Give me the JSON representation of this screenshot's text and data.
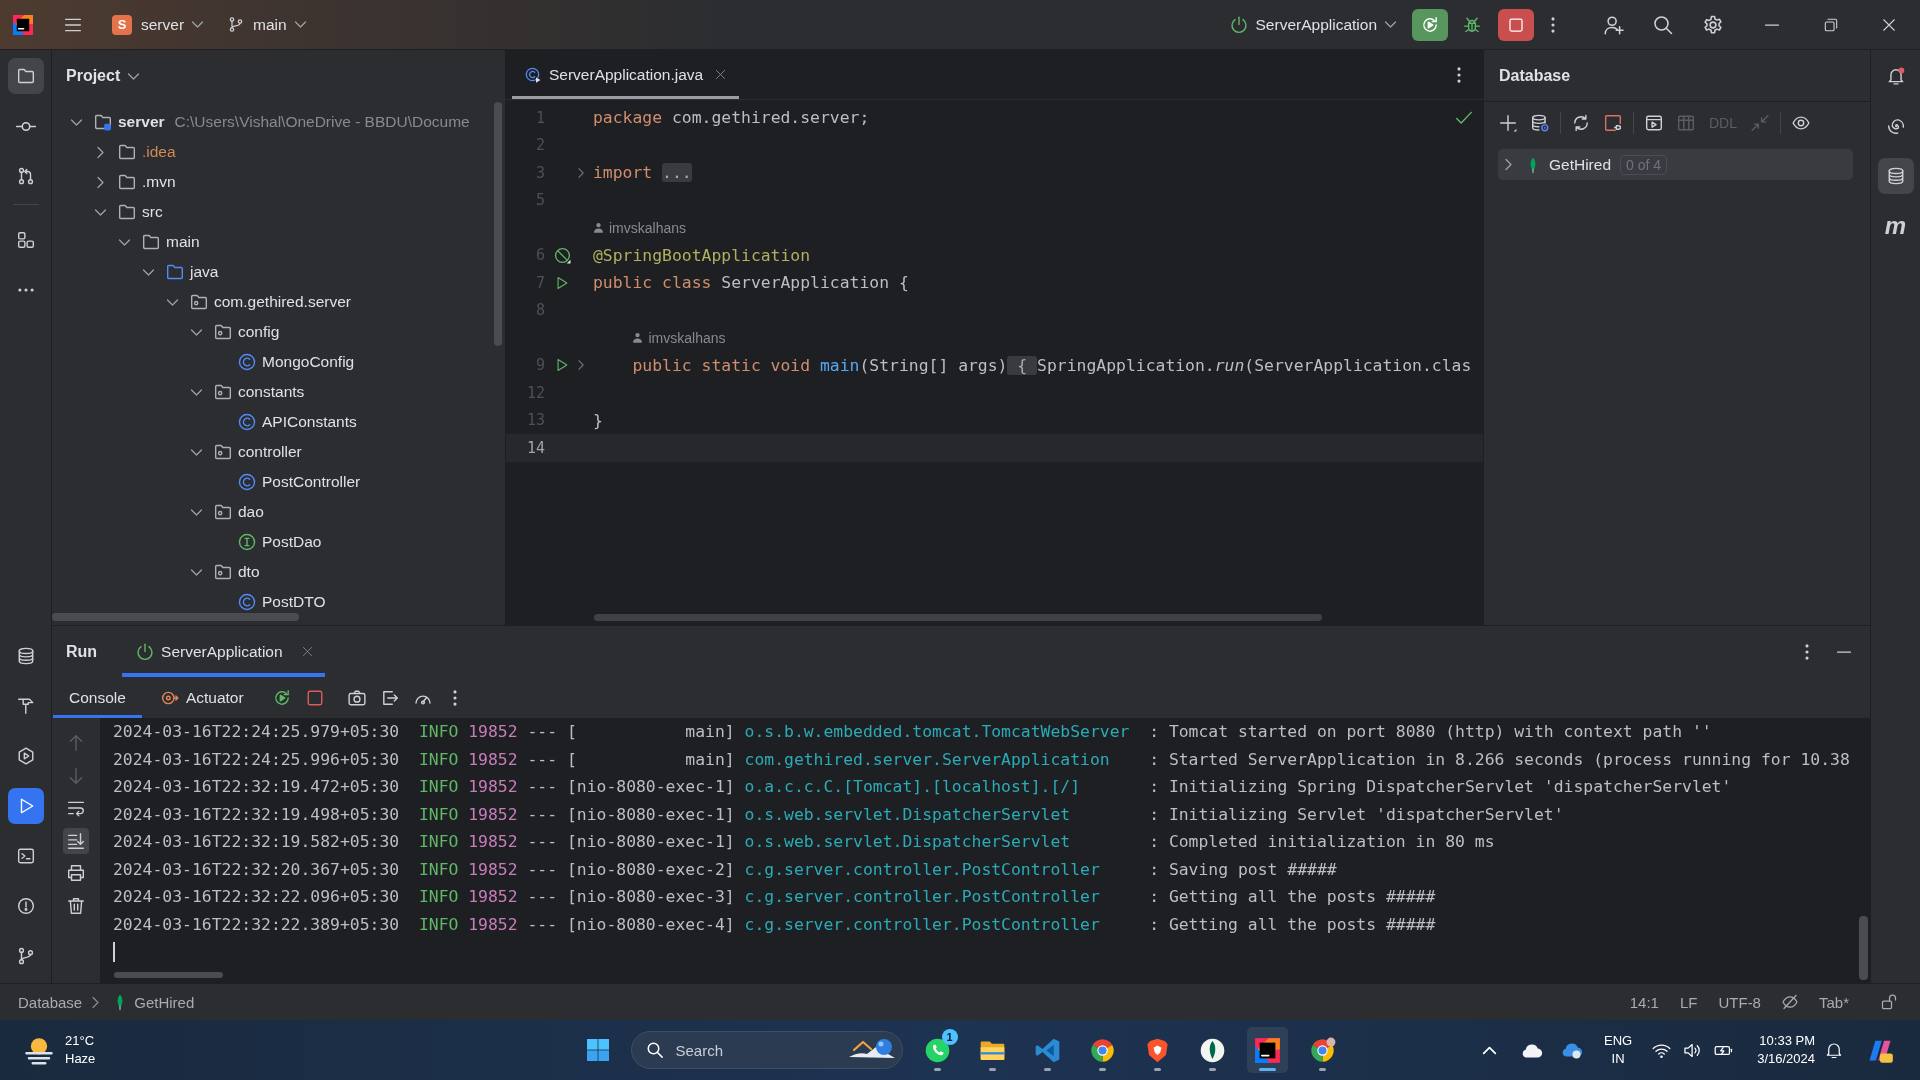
{
  "title_bar": {
    "project": {
      "initial": "S",
      "name": "server"
    },
    "branch": "main",
    "run_configuration": "ServerApplication",
    "running": true
  },
  "left_toolbar": {
    "top": [
      [
        {
          "kind": "folder",
          "selected": true
        },
        {
          "kind": "commit",
          "selected": false
        },
        {
          "kind": "pull-requests",
          "selected": false
        }
      ],
      [
        {
          "kind": "structure",
          "selected": false
        },
        {
          "kind": "more",
          "selected": false
        }
      ]
    ],
    "bottom": [
      {
        "kind": "database",
        "selected": false
      },
      {
        "kind": "build",
        "selected": false
      },
      {
        "kind": "services",
        "selected": false
      },
      {
        "kind": "run",
        "selected": true,
        "focused": true
      },
      {
        "kind": "terminal",
        "selected": false
      },
      {
        "kind": "problems",
        "selected": false
      },
      {
        "kind": "git",
        "selected": false
      }
    ]
  },
  "project_panel": {
    "title": "Project",
    "tree": [
      {
        "name": "server",
        "path": "C:\\Users\\Vishal\\OneDrive - BBDU\\Docume",
        "kind": "module",
        "expanded": true,
        "children": [
          {
            "name": ".idea",
            "kind": "folder",
            "expanded": false,
            "color": "#d08c52"
          },
          {
            "name": ".mvn",
            "kind": "folder",
            "expanded": false
          },
          {
            "name": "src",
            "kind": "folder",
            "expanded": true,
            "children": [
              {
                "name": "main",
                "kind": "folder",
                "expanded": true,
                "children": [
                  {
                    "name": "java",
                    "kind": "source",
                    "expanded": true,
                    "children": [
                      {
                        "name": "com.gethired.server",
                        "kind": "package",
                        "expanded": true,
                        "children": [
                          {
                            "name": "config",
                            "kind": "package",
                            "expanded": true,
                            "children": [
                              {
                                "name": "MongoConfig",
                                "kind": "class"
                              }
                            ]
                          },
                          {
                            "name": "constants",
                            "kind": "package",
                            "expanded": true,
                            "children": [
                              {
                                "name": "APIConstants",
                                "kind": "class"
                              }
                            ]
                          },
                          {
                            "name": "controller",
                            "kind": "package",
                            "expanded": true,
                            "children": [
                              {
                                "name": "PostController",
                                "kind": "class"
                              }
                            ]
                          },
                          {
                            "name": "dao",
                            "kind": "package",
                            "expanded": true,
                            "children": [
                              {
                                "name": "PostDao",
                                "kind": "interface"
                              }
                            ]
                          },
                          {
                            "name": "dto",
                            "kind": "package",
                            "expanded": true,
                            "children": [
                              {
                                "name": "PostDTO",
                                "kind": "class"
                              }
                            ]
                          }
                        ]
                      }
                    ]
                  }
                ]
              }
            ]
          }
        ]
      }
    ]
  },
  "editor": {
    "tabs": [
      {
        "name": "ServerApplication.java",
        "selected": true
      }
    ],
    "lines": [
      {
        "kind": "code",
        "number": "1",
        "folded": false,
        "current": false,
        "tokens": [
          {
            "text": "package ",
            "kind": "keyword"
          },
          {
            "text": "com.gethired.server;",
            "kind": "plain"
          }
        ]
      },
      {
        "kind": "code",
        "number": "2",
        "folded": false,
        "current": false
      },
      {
        "kind": "code",
        "number": "3",
        "folded": true,
        "current": false,
        "tokens": [
          {
            "text": "import ",
            "kind": "keyword"
          },
          {
            "text": "...",
            "kind": "fold"
          }
        ]
      },
      {
        "kind": "code",
        "number": "5",
        "folded": false,
        "current": false
      },
      {
        "kind": "author",
        "text": "imvskalhans"
      },
      {
        "kind": "code",
        "number": "6",
        "gutter": {
          "kind": "bean"
        },
        "folded": false,
        "current": false,
        "tokens": [
          {
            "text": "@SpringBootApplication",
            "kind": "annotation"
          }
        ]
      },
      {
        "kind": "code",
        "number": "7",
        "gutter": {
          "kind": "run"
        },
        "folded": false,
        "current": false,
        "tokens": [
          {
            "text": "public class ",
            "kind": "keyword"
          },
          {
            "text": "ServerApplication {",
            "kind": "plain"
          }
        ]
      },
      {
        "kind": "code",
        "number": "8",
        "folded": false,
        "current": false
      },
      {
        "kind": "author",
        "text": "imvskalhans"
      },
      {
        "kind": "code",
        "number": "9",
        "gutter": {
          "kind": "run"
        },
        "folded": true,
        "current": false,
        "tokens": [
          {
            "text": "    public static void ",
            "kind": "keyword"
          },
          {
            "text": "main",
            "kind": "method"
          },
          {
            "text": "(String[] args)",
            "kind": "plain"
          },
          {
            "text": " { ",
            "kind": "fold"
          },
          {
            "text": "SpringApplication.",
            "kind": "plain"
          },
          {
            "text": "run",
            "kind": "static"
          },
          {
            "text": "(ServerApplication.clas",
            "kind": "plain"
          }
        ]
      },
      {
        "kind": "code",
        "number": "12",
        "folded": false,
        "current": false
      },
      {
        "kind": "code",
        "number": "13",
        "folded": false,
        "current": false,
        "tokens": [
          {
            "text": "}",
            "kind": "plain"
          }
        ]
      },
      {
        "kind": "code",
        "number": "14",
        "folded": false,
        "current": true
      }
    ]
  },
  "database_panel": {
    "title": "Database",
    "toolbar": [
      [
        {
          "kind": "add",
          "disabled": false
        },
        {
          "kind": "data-source-properties",
          "disabled": false
        }
      ],
      [
        {
          "kind": "refresh",
          "disabled": false
        },
        {
          "kind": "disconnect",
          "disabled": false
        }
      ],
      [
        {
          "kind": "console",
          "disabled": false
        },
        {
          "kind": "table",
          "disabled": true
        },
        {
          "kind": "ddl",
          "label": "DDL",
          "disabled": true
        },
        {
          "kind": "compare",
          "disabled": true
        }
      ],
      [
        {
          "kind": "view-options",
          "disabled": false
        }
      ]
    ],
    "tree": [
      {
        "name": "GetHired",
        "count": "0 of 4",
        "expanded": false,
        "selected": true
      }
    ]
  },
  "right_toolbar": [
    {
      "kind": "notifications",
      "unread": true,
      "selected": false
    },
    {
      "kind": "ai-assistant",
      "selected": false
    },
    {
      "kind": "database",
      "selected": true
    },
    {
      "kind": "letter",
      "label": "m",
      "selected": false
    }
  ],
  "run_panel": {
    "title": "Run",
    "tabs": [
      {
        "name": "ServerApplication",
        "selected": true
      }
    ],
    "subtabs": [
      {
        "kind": "console",
        "label": "Console",
        "selected": true
      },
      {
        "kind": "actuator",
        "label": "Actuator",
        "selected": false
      }
    ],
    "toolbar": [
      {
        "kind": "rerun"
      },
      {
        "kind": "stop"
      },
      {
        "kind": "screenshot"
      },
      {
        "kind": "exit"
      },
      {
        "kind": "profiler"
      },
      {
        "kind": "more"
      }
    ],
    "side_tools": [
      {
        "kind": "up",
        "disabled": true,
        "selected": false
      },
      {
        "kind": "down",
        "disabled": true,
        "selected": false
      },
      {
        "kind": "soft-wrap",
        "disabled": false,
        "selected": false
      },
      {
        "kind": "scroll-to-end",
        "disabled": false,
        "selected": true
      },
      {
        "kind": "print",
        "disabled": false,
        "selected": false
      },
      {
        "kind": "clear",
        "disabled": false,
        "selected": false
      }
    ],
    "log": [
      {
        "timestamp": "2024-03-16T22:24:25.979+05:30",
        "level": "INFO",
        "pid": "19852",
        "separator": "---",
        "thread": "[           main]",
        "logger": "o.s.b.w.embedded.tomcat.TomcatWebServer",
        "message": ": Tomcat started on port 8080 (http) with context path ''"
      },
      {
        "timestamp": "2024-03-16T22:24:25.996+05:30",
        "level": "INFO",
        "pid": "19852",
        "separator": "---",
        "thread": "[           main]",
        "logger": "com.gethired.server.ServerApplication",
        "message": ": Started ServerApplication in 8.266 seconds (process running for 10.38"
      },
      {
        "timestamp": "2024-03-16T22:32:19.472+05:30",
        "level": "INFO",
        "pid": "19852",
        "separator": "---",
        "thread": "[nio-8080-exec-1]",
        "logger": "o.a.c.c.C.[Tomcat].[localhost].[/]",
        "message": ": Initializing Spring DispatcherServlet 'dispatcherServlet'"
      },
      {
        "timestamp": "2024-03-16T22:32:19.498+05:30",
        "level": "INFO",
        "pid": "19852",
        "separator": "---",
        "thread": "[nio-8080-exec-1]",
        "logger": "o.s.web.servlet.DispatcherServlet",
        "message": ": Initializing Servlet 'dispatcherServlet'"
      },
      {
        "timestamp": "2024-03-16T22:32:19.582+05:30",
        "level": "INFO",
        "pid": "19852",
        "separator": "---",
        "thread": "[nio-8080-exec-1]",
        "logger": "o.s.web.servlet.DispatcherServlet",
        "message": ": Completed initialization in 80 ms"
      },
      {
        "timestamp": "2024-03-16T22:32:20.367+05:30",
        "level": "INFO",
        "pid": "19852",
        "separator": "---",
        "thread": "[nio-8080-exec-2]",
        "logger": "c.g.server.controller.PostController",
        "message": ": Saving post #####"
      },
      {
        "timestamp": "2024-03-16T22:32:22.096+05:30",
        "level": "INFO",
        "pid": "19852",
        "separator": "---",
        "thread": "[nio-8080-exec-3]",
        "logger": "c.g.server.controller.PostController",
        "message": ": Getting all the posts #####"
      },
      {
        "timestamp": "2024-03-16T22:32:22.389+05:30",
        "level": "INFO",
        "pid": "19852",
        "separator": "---",
        "thread": "[nio-8080-exec-4]",
        "logger": "c.g.server.controller.PostController",
        "message": ": Getting all the posts #####"
      }
    ]
  },
  "status_bar": {
    "breadcrumbs": [
      {
        "kind": "text",
        "label": "Database"
      },
      {
        "kind": "mongo",
        "label": "GetHired"
      }
    ],
    "position": "14:1",
    "line_separator": "LF",
    "encoding": "UTF-8",
    "indent": "Tab*"
  },
  "taskbar": {
    "weather": {
      "temperature": "21°C",
      "condition": "Haze"
    },
    "search": {
      "label": "Search"
    },
    "apps": [
      {
        "kind": "whatsapp",
        "badge": "1",
        "active": false
      },
      {
        "kind": "file-explorer",
        "active": false
      },
      {
        "kind": "vscode",
        "active": false
      },
      {
        "kind": "chrome",
        "active": false
      },
      {
        "kind": "brave",
        "active": false
      },
      {
        "kind": "mongodb-compass",
        "active": false
      },
      {
        "kind": "intellij",
        "active": true
      },
      {
        "kind": "chrome-profile",
        "active": false
      }
    ],
    "tray": {
      "language": "ENG",
      "region": "IN",
      "time": "10:33 PM",
      "date": "3/16/2024"
    }
  }
}
